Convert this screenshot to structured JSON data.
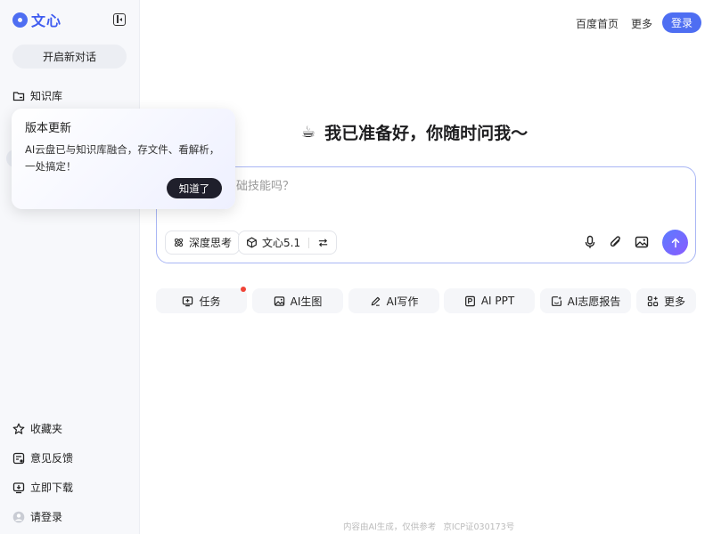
{
  "brand": {
    "name": "文心",
    "accent": "#4e6ef2"
  },
  "sidebar": {
    "new_chat_label": "开启新对话",
    "knowledge_label": "知识库",
    "bottom_items": [
      {
        "label": "收藏夹",
        "icon": "star-icon"
      },
      {
        "label": "意见反馈",
        "icon": "feedback-icon"
      },
      {
        "label": "立即下载",
        "icon": "download-icon"
      },
      {
        "label": "请登录",
        "icon": "user-icon"
      }
    ]
  },
  "tooltip": {
    "title": "版本更新",
    "body": "AI云盘已与知识库融合，存文件、看解析，一处搞定！",
    "button_label": "知道了"
  },
  "header": {
    "links": [
      "百度首页",
      "更多"
    ],
    "login_label": "登录"
  },
  "main": {
    "emoji": "☕",
    "headline": "我已准备好，你随时问我～",
    "input": {
      "placeholder_visible": "础技能吗？",
      "deep_think_label": "深度思考",
      "model_label": "文心5.1"
    },
    "features": [
      {
        "label": "任务",
        "icon": "task-icon"
      },
      {
        "label": "AI生图",
        "icon": "image-gen-icon"
      },
      {
        "label": "AI写作",
        "icon": "pen-icon"
      },
      {
        "label": "AI PPT",
        "icon": "ppt-icon"
      },
      {
        "label": "AI志愿报告",
        "icon": "report-icon"
      },
      {
        "label": "更多",
        "icon": "grid-icon"
      }
    ]
  },
  "footer": {
    "disclaimer": "内容由AI生成，仅供参考",
    "icp": "京ICP证030173号"
  }
}
